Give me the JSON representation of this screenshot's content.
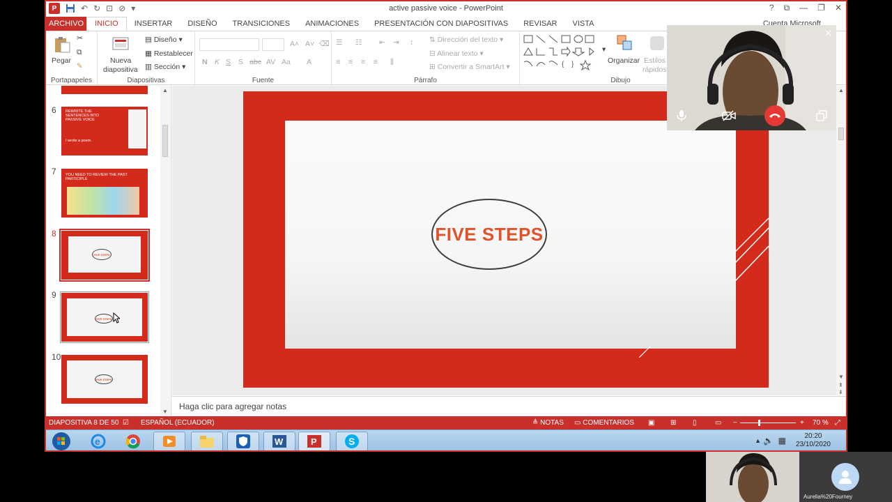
{
  "app": {
    "title": "active passive voice - PowerPoint",
    "account": "Cuenta Microsoft",
    "logo_letter": "P"
  },
  "tabs": [
    {
      "label": "ARCHIVO"
    },
    {
      "label": "INICIO"
    },
    {
      "label": "INSERTAR"
    },
    {
      "label": "DISEÑO"
    },
    {
      "label": "TRANSICIONES"
    },
    {
      "label": "ANIMACIONES"
    },
    {
      "label": "PRESENTACIÓN CON DIAPOSITIVAS"
    },
    {
      "label": "REVISAR"
    },
    {
      "label": "VISTA"
    }
  ],
  "ribbon": {
    "paste": "Pegar",
    "new_slide_1": "Nueva",
    "new_slide_2": "diapositiva",
    "design": "Diseño",
    "reset": "Restablecer",
    "section": "Sección",
    "text_direction": "Dirección del texto",
    "align_text": "Alinear texto",
    "smartart": "Convertir a SmartArt",
    "arrange": "Organizar",
    "styles_1": "Estilos",
    "styles_2": "rápidos",
    "groups": {
      "clipboard": "Portapapeles",
      "slides": "Diapositivas",
      "font": "Fuente",
      "paragraph": "Párrafo",
      "drawing": "Dibujo"
    }
  },
  "thumbnails": [
    {
      "num": "6",
      "title": "REWRITE THE SENTENCES INTO PASSIVE VOICE",
      "subtitle": "I wrote a poem."
    },
    {
      "num": "7",
      "title": "YOU NEED TO REVIEW THE PAST PARTICIPLE"
    },
    {
      "num": "8",
      "oval": "FIVE STEPS"
    },
    {
      "num": "9",
      "oval": "FIVE STEPS"
    },
    {
      "num": "10",
      "oval": "FIVE STEPS"
    }
  ],
  "slide": {
    "main_text": "FIVE STEPS"
  },
  "notes_placeholder": "Haga clic para agregar notas",
  "status": {
    "slide_counter": "DIAPOSITIVA 8 DE 50",
    "language": "ESPAÑOL (ECUADOR)",
    "notes": "NOTAS",
    "comments": "COMENTARIOS",
    "zoom": "70 %"
  },
  "taskbar": {
    "time": "20:20",
    "date": "23/10/2020"
  },
  "video": {
    "participant_name": "Aurelia%20Fourney"
  },
  "colors": {
    "accent": "#c9302c",
    "slide_red": "#d42a1c",
    "slide_text": "#e0522a"
  }
}
